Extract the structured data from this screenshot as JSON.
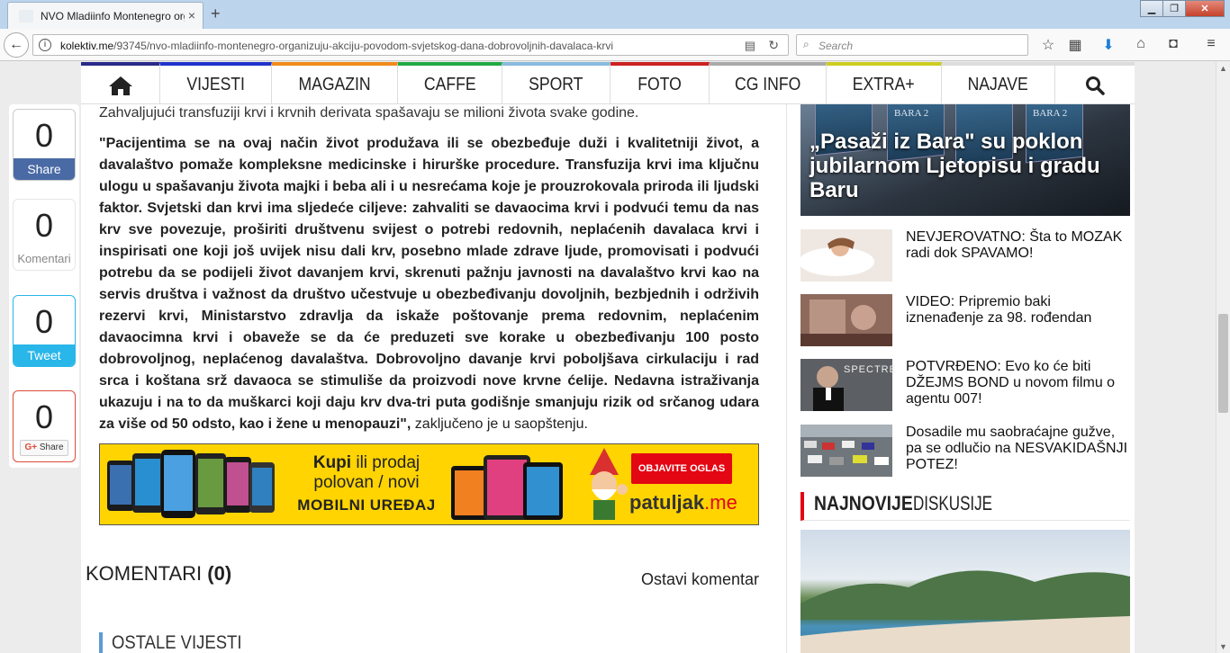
{
  "browser": {
    "tab_title": "NVO Mladiinfo Montenegro organizuju akciju",
    "tab_close": "×",
    "new_tab": "+",
    "url_domain": "kolektiv.me",
    "url_path": "/93745/nvo-mladiinfo-montenegro-organizuju-akciju-povodom-svjetskog-dana-dobrovoljnih-davalaca-krvi",
    "search_placeholder": "Search"
  },
  "nav": {
    "items": [
      "VIJESTI",
      "MAGAZIN",
      "CAFFE",
      "SPORT",
      "FOTO",
      "CG INFO",
      "EXTRA+",
      "NAJAVE"
    ],
    "colors": [
      "#2a2a8a",
      "#2233cc",
      "#f08a1c",
      "#22aa44",
      "#88bbdd",
      "#cc2222",
      "#aaaaaa",
      "#cccc22",
      "#dddddd"
    ]
  },
  "share": {
    "facebook": {
      "count": "0",
      "label": "Share",
      "color": "#4a6aa5"
    },
    "comments": {
      "count": "0",
      "label": "Komentari"
    },
    "twitter": {
      "count": "0",
      "label": "Tweet",
      "color": "#29b6e8"
    },
    "gplus": {
      "count": "0",
      "label": "Share",
      "logo": "G+"
    }
  },
  "article": {
    "intro": "Zahvaljujući transfuziji krvi i krvnih derivata spašavaju se milioni života svake godine.",
    "quote_bold": "\"Pacijentima se na ovaj način život produžava ili se obezbeđuje duži i kvalitetniji život, a davalaštvo pomaže kompleksne medicinske i hirurške procedure. Transfuzija krvi ima ključnu ulogu u spašavanju života majki i beba ali i u nesrećama koje je prouzrokovala priroda ili ljudski faktor. Svjetski dan krvi ima sljedeće ciljeve: zahvaliti se davaocima krvi i podvući temu da nas krv sve povezuje, proširiti društvenu svijest o potrebi redovnih, neplaćenih davalaca krvi i inspirisati one koji još uvijek nisu dali krv, posebno mlade zdrave ljude, promovisati i podvući potrebu da se podijeli život davanjem krvi, skrenuti pažnju javnosti na davalaštvo krvi kao na servis društva i važnost da društvo učestvuje u obezbeđivanju dovoljnih, bezbjednih i održivih rezervi krvi, Ministarstvo zdravlja da iskaže poštovanje prema redovnim, neplaćenim davaocimna krvi i obaveže se da će preduzeti sve korake u obezbeđivanju 100 posto dobrovoljnog, neplaćenog davalaštva. Dobrovoljno davanje krvi poboljšava cirkulaciju i rad srca i koštana srž davaoca se stimuliše da proizvodi nove krvne ćelije. Nedavna istraživanja ukazuju i na to da muškarci koji daju krv dva-tri puta godišnje smanjuju rizik od srčanog udara za više od 50 odsto, kao i žene u menopauzi\",",
    "quote_tail": " zaključeno je u saopštenju."
  },
  "banner": {
    "line1a": "Kupi",
    "line1b": " ili prodaj",
    "line1c": "polovan / novi",
    "line2": "MOBILNI UREĐAJ",
    "cta": "OBJAVITE OGLAS",
    "brand": "patuljak",
    "brand_tld": ".me"
  },
  "comments": {
    "heading": "KOMENTARI ",
    "count": "(0)",
    "leave": "Ostavi komentar"
  },
  "other_news": "OSTALE VIJESTI",
  "sidebar": {
    "feature_title": "„Pasaži iz Bara\" su poklon jubilarnom Ljetopisu i gradu Baru",
    "feature_book_label": "BARA 2",
    "news": [
      "NEVJEROVATNO: Šta to MOZAK radi dok SPAVAMO!",
      "VIDEO: Pripremio baki iznenađenje za 98. rođendan",
      "POTVRĐENO: Evo ko će biti DŽEJMS BOND u novom filmu o agentu 007!",
      "Dosadile mu saobraćajne gužve, pa se odlučio na NESVAKIDAŠNJI POTEZ!"
    ],
    "thumb_spectre": "SPECTRE",
    "discussion_bold": "NAJNOVIJE",
    "discussion_rest": " DISKUSIJE"
  }
}
